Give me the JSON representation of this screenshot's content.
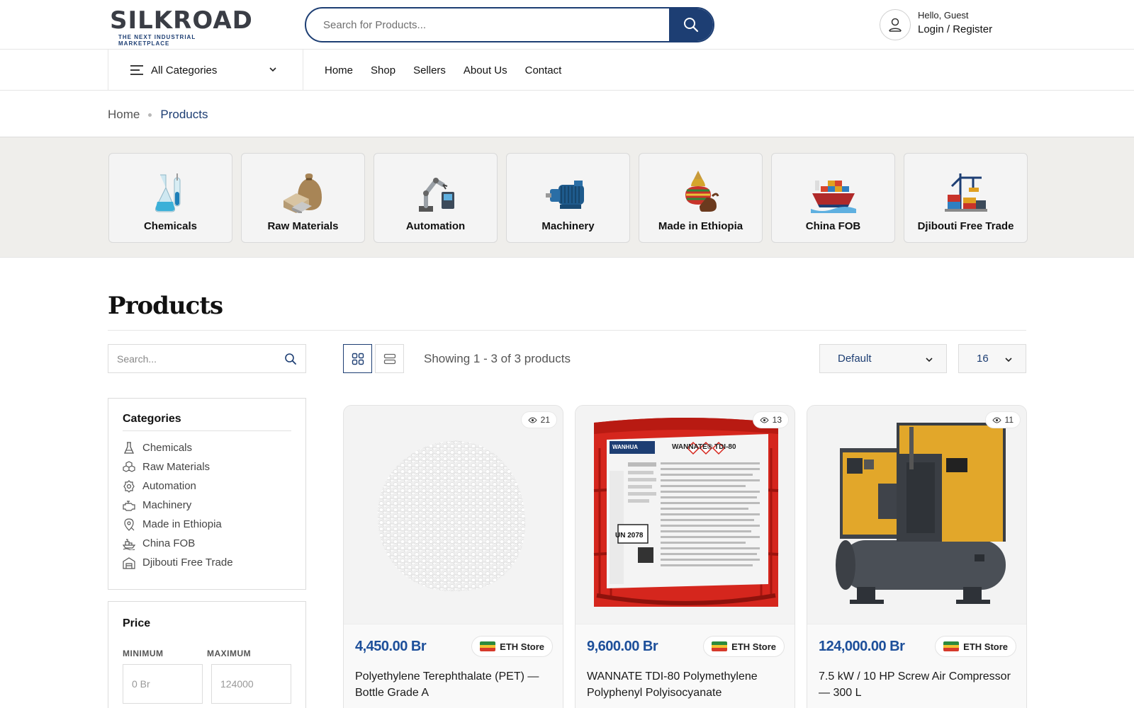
{
  "header": {
    "logo_text": "SILKROAD",
    "logo_tagline": "THE NEXT INDUSTRIAL MARKETPLACE",
    "search_placeholder": "Search for Products...",
    "greeting": "Hello, Guest",
    "login_link": "Login / Register"
  },
  "nav": {
    "categories_label": "All Categories",
    "links": [
      "Home",
      "Shop",
      "Sellers",
      "About Us",
      "Contact"
    ]
  },
  "breadcrumb": {
    "home": "Home",
    "current": "Products"
  },
  "category_cards": [
    {
      "label": "Chemicals",
      "icon": "flask-icon"
    },
    {
      "label": "Raw Materials",
      "icon": "raw-materials-icon"
    },
    {
      "label": "Automation",
      "icon": "robot-arm-icon"
    },
    {
      "label": "Machinery",
      "icon": "motor-icon"
    },
    {
      "label": "Made in Ethiopia",
      "icon": "basket-icon"
    },
    {
      "label": "China FOB",
      "icon": "cargo-ship-icon"
    },
    {
      "label": "Djibouti Free Trade",
      "icon": "port-crane-icon"
    }
  ],
  "page_title": "Products",
  "sidebar": {
    "search_placeholder": "Search...",
    "categories_title": "Categories",
    "categories": [
      {
        "label": "Chemicals",
        "icon": "flask-icon"
      },
      {
        "label": "Raw Materials",
        "icon": "boxes-icon"
      },
      {
        "label": "Automation",
        "icon": "gear-icon"
      },
      {
        "label": "Machinery",
        "icon": "engine-icon"
      },
      {
        "label": "Made in Ethiopia",
        "icon": "location-icon"
      },
      {
        "label": "China FOB",
        "icon": "ship-icon"
      },
      {
        "label": "Djibouti Free Trade",
        "icon": "warehouse-icon"
      }
    ],
    "price_title": "Price",
    "min_label": "MINIMUM",
    "max_label": "MAXIMUM",
    "min_placeholder": "0 Br",
    "max_placeholder": "124000"
  },
  "toolbar": {
    "showing_text": "Showing 1 - 3 of 3 products",
    "sort_value": "Default",
    "per_page_value": "16"
  },
  "products": [
    {
      "views": "21",
      "price": "4,450.00 Br",
      "store": "ETH Store",
      "name": "Polyethylene Terephthalate (PET) — Bottle Grade A"
    },
    {
      "views": "13",
      "price": "9,600.00 Br",
      "store": "ETH Store",
      "name": "WANNATE TDI-80 Polymethylene Polyphenyl Polyisocyanate"
    },
    {
      "views": "11",
      "price": "124,000.00 Br",
      "store": "ETH Store",
      "name": "7.5 kW / 10 HP Screw Air Compressor — 300 L"
    }
  ],
  "product_images": {
    "drum_label_brand": "WANHUA",
    "drum_label_title": "WANNATE® TDI-80",
    "drum_label_un": "UN 2078"
  },
  "colors": {
    "brand_navy": "#1d3e73",
    "price_blue": "#1d4f9a",
    "strip_bg": "#efeeeb"
  }
}
